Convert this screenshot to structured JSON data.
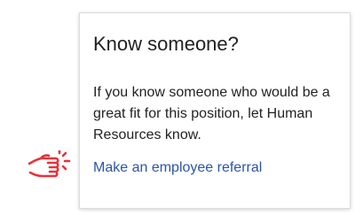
{
  "card": {
    "title": "Know someone?",
    "body": "If you know someone who would be a great fit for this position, let Human Resources know.",
    "link_label": "Make an employee referral"
  },
  "icons": {
    "pointer": "pointing-hand-icon"
  },
  "colors": {
    "link": "#2b55a8",
    "pointer_icon": "#e8323a",
    "text": "#222222"
  }
}
